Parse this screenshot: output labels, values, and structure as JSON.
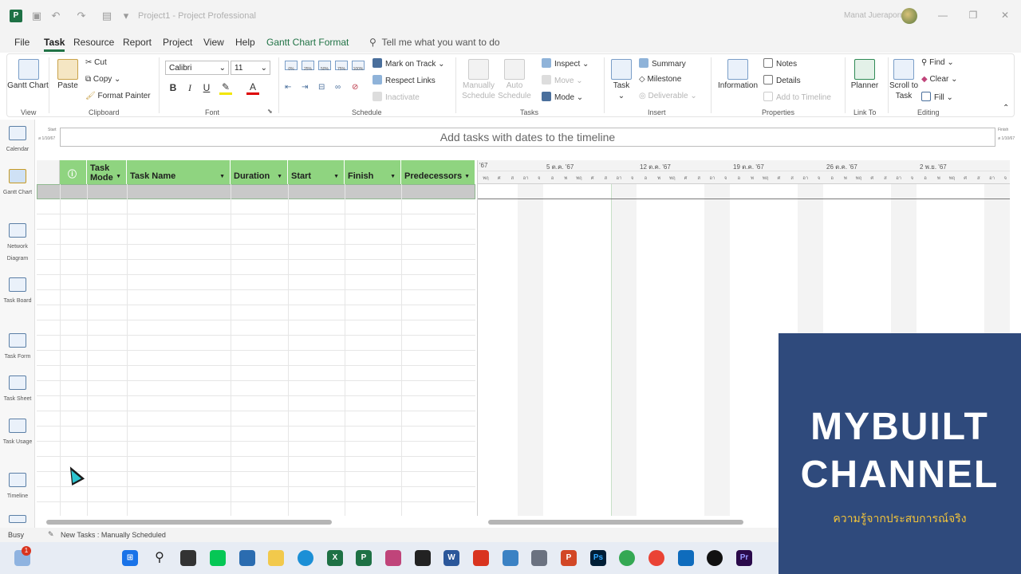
{
  "window": {
    "title": "Project1  -  Project Professional",
    "user": "Manat Jueraporn"
  },
  "menu": {
    "tabs": [
      "File",
      "Task",
      "Resource",
      "Report",
      "Project",
      "View",
      "Help",
      "Gantt Chart Format"
    ],
    "active_tab": "Task",
    "tell_me": "Tell me what you want to do"
  },
  "ribbon": {
    "view": {
      "label": "View",
      "gantt_chart": "Gantt Chart"
    },
    "clipboard": {
      "label": "Clipboard",
      "paste": "Paste",
      "cut": "Cut",
      "copy": "Copy",
      "format_painter": "Format Painter"
    },
    "font": {
      "label": "Font",
      "family": "Calibri",
      "size": "11",
      "bold": "B",
      "italic": "I",
      "underline": "U"
    },
    "schedule": {
      "label": "Schedule",
      "mark_on_track": "Mark on Track",
      "respect_links": "Respect Links",
      "inactivate": "Inactivate",
      "pct": [
        "0%",
        "25%",
        "50%",
        "75%",
        "100%"
      ]
    },
    "tasks": {
      "label": "Tasks",
      "manually": "Manually Schedule",
      "auto": "Auto Schedule",
      "inspect": "Inspect",
      "move": "Move",
      "mode": "Mode"
    },
    "insert": {
      "label": "Insert",
      "task": "Task",
      "summary": "Summary",
      "milestone": "Milestone",
      "deliverable": "Deliverable"
    },
    "properties": {
      "label": "Properties",
      "information": "Information",
      "notes": "Notes",
      "details": "Details",
      "add_to_timeline": "Add to Timeline"
    },
    "link_to": {
      "label": "Link To",
      "planner": "Planner"
    },
    "editing": {
      "label": "Editing",
      "scroll_to_task": "Scroll to Task",
      "find": "Find",
      "clear": "Clear",
      "fill": "Fill"
    }
  },
  "views": [
    {
      "name": "calendar",
      "label": "Calendar"
    },
    {
      "name": "gantt-chart",
      "label": "Gantt Chart"
    },
    {
      "name": "network-diagram",
      "label": "Network Diagram"
    },
    {
      "name": "task-board",
      "label": "Task Board"
    },
    {
      "name": "task-form",
      "label": "Task Form"
    },
    {
      "name": "task-sheet",
      "label": "Task Sheet"
    },
    {
      "name": "task-usage",
      "label": "Task Usage"
    },
    {
      "name": "timeline",
      "label": "Timeline"
    }
  ],
  "timeline": {
    "start_label": "Start",
    "start_date": "ส 1/10/67",
    "finish_label": "Finish",
    "finish_date": "ส 1/10/67",
    "placeholder": "Add tasks with dates to the timeline"
  },
  "table": {
    "columns": [
      "Task Mode",
      "Task Name",
      "Duration",
      "Start",
      "Finish",
      "Predecessors"
    ]
  },
  "gantt": {
    "weeks": [
      "'67",
      "5 ต.ค. '67",
      "12 ต.ค. '67",
      "19 ต.ค. '67",
      "26 ต.ค. '67",
      "2 พ.ย. '67"
    ],
    "day_letters": [
      "อา",
      "จ",
      "อ",
      "พ",
      "พฤ",
      "ศ",
      "ส"
    ]
  },
  "status": {
    "mode": "Busy",
    "new_tasks": "New Tasks : Manually Scheduled"
  },
  "taskbar": {
    "notification_count": "1"
  },
  "watermark": {
    "line1": "MYBUILT",
    "line2": "CHANNEL",
    "sub": "ความรู้จากประสบการณ์จริง"
  }
}
